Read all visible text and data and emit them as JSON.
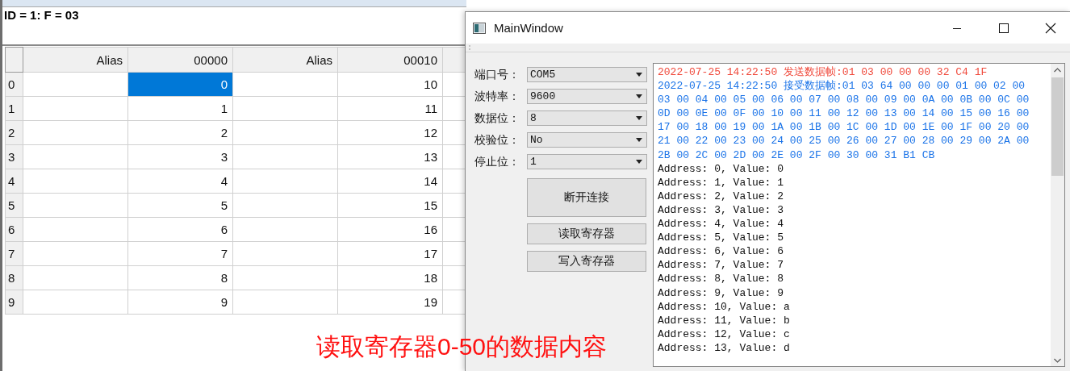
{
  "background_window": {
    "header": "ID = 1: F = 03",
    "table": {
      "columns": [
        {
          "kind": "alias",
          "label": "Alias"
        },
        {
          "kind": "value",
          "label": "00000"
        },
        {
          "kind": "alias",
          "label": "Alias"
        },
        {
          "kind": "value",
          "label": "00010"
        }
      ],
      "rows": [
        {
          "label": "0",
          "values": [
            {
              "text": "0",
              "selected": true
            },
            {
              "text": "10",
              "selected": false
            }
          ]
        },
        {
          "label": "1",
          "values": [
            {
              "text": "1",
              "selected": false
            },
            {
              "text": "11",
              "selected": false
            }
          ]
        },
        {
          "label": "2",
          "values": [
            {
              "text": "2",
              "selected": false
            },
            {
              "text": "12",
              "selected": false
            }
          ]
        },
        {
          "label": "3",
          "values": [
            {
              "text": "3",
              "selected": false
            },
            {
              "text": "13",
              "selected": false
            }
          ]
        },
        {
          "label": "4",
          "values": [
            {
              "text": "4",
              "selected": false
            },
            {
              "text": "14",
              "selected": false
            }
          ]
        },
        {
          "label": "5",
          "values": [
            {
              "text": "5",
              "selected": false
            },
            {
              "text": "15",
              "selected": false
            }
          ]
        },
        {
          "label": "6",
          "values": [
            {
              "text": "6",
              "selected": false
            },
            {
              "text": "16",
              "selected": false
            }
          ]
        },
        {
          "label": "7",
          "values": [
            {
              "text": "7",
              "selected": false
            },
            {
              "text": "17",
              "selected": false
            }
          ]
        },
        {
          "label": "8",
          "values": [
            {
              "text": "8",
              "selected": false
            },
            {
              "text": "18",
              "selected": false
            }
          ]
        },
        {
          "label": "9",
          "values": [
            {
              "text": "9",
              "selected": false
            },
            {
              "text": "19",
              "selected": false
            }
          ]
        }
      ]
    }
  },
  "main_window": {
    "title": "MainWindow",
    "settings": [
      {
        "label": "端口号：",
        "value": "COM5"
      },
      {
        "label": "波特率：",
        "value": "9600"
      },
      {
        "label": "数据位：",
        "value": "8"
      },
      {
        "label": "校验位：",
        "value": "No"
      },
      {
        "label": "停止位：",
        "value": "1"
      }
    ],
    "buttons": [
      {
        "kind": "large",
        "label": "断开连接"
      },
      {
        "kind": "small",
        "label": "读取寄存器"
      },
      {
        "kind": "small",
        "label": "写入寄存器"
      }
    ],
    "log": [
      {
        "kind": "sent",
        "text": "2022-07-25 14:22:50 发送数据帧:01 03 00 00 00 32 C4 1F"
      },
      {
        "kind": "received",
        "text": "2022-07-25 14:22:50 接受数据帧:01 03 64 00 00 00 01 00 02 00"
      },
      {
        "kind": "received",
        "text": "03 00 04 00 05 00 06 00 07 00 08 00 09 00 0A 00 0B 00 0C 00"
      },
      {
        "kind": "received",
        "text": "0D 00 0E 00 0F 00 10 00 11 00 12 00 13 00 14 00 15 00 16 00"
      },
      {
        "kind": "received",
        "text": "17 00 18 00 19 00 1A 00 1B 00 1C 00 1D 00 1E 00 1F 00 20 00"
      },
      {
        "kind": "received",
        "text": "21 00 22 00 23 00 24 00 25 00 26 00 27 00 28 00 29 00 2A 00"
      },
      {
        "kind": "received",
        "text": "2B 00 2C 00 2D 00 2E 00 2F 00 30 00 31 B1 CB"
      },
      {
        "kind": "plain",
        "text": "Address: 0, Value: 0"
      },
      {
        "kind": "plain",
        "text": "Address: 1, Value: 1"
      },
      {
        "kind": "plain",
        "text": "Address: 2, Value: 2"
      },
      {
        "kind": "plain",
        "text": "Address: 3, Value: 3"
      },
      {
        "kind": "plain",
        "text": "Address: 4, Value: 4"
      },
      {
        "kind": "plain",
        "text": "Address: 5, Value: 5"
      },
      {
        "kind": "plain",
        "text": "Address: 6, Value: 6"
      },
      {
        "kind": "plain",
        "text": "Address: 7, Value: 7"
      },
      {
        "kind": "plain",
        "text": "Address: 8, Value: 8"
      },
      {
        "kind": "plain",
        "text": "Address: 9, Value: 9"
      },
      {
        "kind": "plain",
        "text": "Address: 10, Value: a"
      },
      {
        "kind": "plain",
        "text": "Address: 11, Value: b"
      },
      {
        "kind": "plain",
        "text": "Address: 12, Value: c"
      },
      {
        "kind": "plain",
        "text": "Address: 13, Value: d"
      }
    ]
  },
  "annotation": "读取寄存器0-50的数据内容"
}
